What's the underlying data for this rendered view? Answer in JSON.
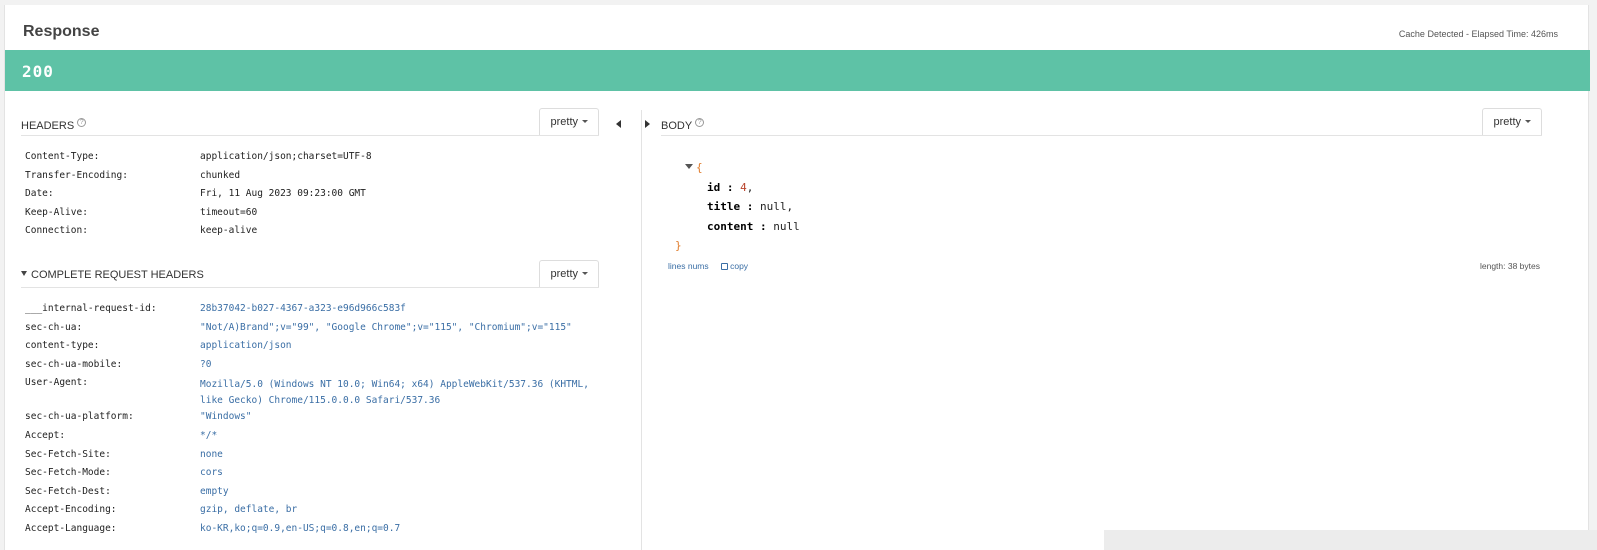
{
  "response": {
    "title": "Response",
    "elapsed": "Cache Detected - Elapsed Time: 426ms",
    "status_code": "200",
    "status_color": "#5ec2a6"
  },
  "headers": {
    "label": "HEADERS",
    "help": "?",
    "pretty": "pretty",
    "rows": [
      {
        "key": "Content-Type:",
        "value": "application/json;charset=UTF-8"
      },
      {
        "key": "Transfer-Encoding:",
        "value": "chunked"
      },
      {
        "key": "Date:",
        "value": "Fri, 11 Aug 2023 09:23:00 GMT"
      },
      {
        "key": "Keep-Alive:",
        "value": "timeout=60"
      },
      {
        "key": "Connection:",
        "value": "keep-alive"
      }
    ]
  },
  "request_headers": {
    "label": "COMPLETE REQUEST HEADERS",
    "pretty": "pretty",
    "rows": [
      {
        "key": "___internal-request-id:",
        "value": "28b37042-b027-4367-a323-e96d966c583f"
      },
      {
        "key": "sec-ch-ua:",
        "value": "\"Not/A)Brand\";v=\"99\", \"Google Chrome\";v=\"115\", \"Chromium\";v=\"115\""
      },
      {
        "key": "content-type:",
        "value": "application/json"
      },
      {
        "key": "sec-ch-ua-mobile:",
        "value": "?0"
      },
      {
        "key": "User-Agent:",
        "value": "Mozilla/5.0 (Windows NT 10.0; Win64; x64) AppleWebKit/537.36 (KHTML, like Gecko) Chrome/115.0.0.0 Safari/537.36"
      },
      {
        "key": "sec-ch-ua-platform:",
        "value": "\"Windows\""
      },
      {
        "key": "Accept:",
        "value": "*/*"
      },
      {
        "key": "Sec-Fetch-Site:",
        "value": "none"
      },
      {
        "key": "Sec-Fetch-Mode:",
        "value": "cors"
      },
      {
        "key": "Sec-Fetch-Dest:",
        "value": "empty"
      },
      {
        "key": "Accept-Encoding:",
        "value": "gzip, deflate, br"
      },
      {
        "key": "Accept-Language:",
        "value": "ko-KR,ko;q=0.9,en-US;q=0.8,en;q=0.7"
      }
    ]
  },
  "body": {
    "label": "BODY",
    "help": "?",
    "pretty": "pretty",
    "open_brace": "{",
    "close_brace": "}",
    "fields": [
      {
        "key": "id",
        "sep": " : ",
        "value": "4",
        "trail": ","
      },
      {
        "key": "title",
        "sep": " : ",
        "value": "null",
        "trail": ","
      },
      {
        "key": "content",
        "sep": " : ",
        "value": "null",
        "trail": ""
      }
    ],
    "lines_nums": "lines nums",
    "copy": "copy",
    "length": "length: 38 bytes"
  }
}
